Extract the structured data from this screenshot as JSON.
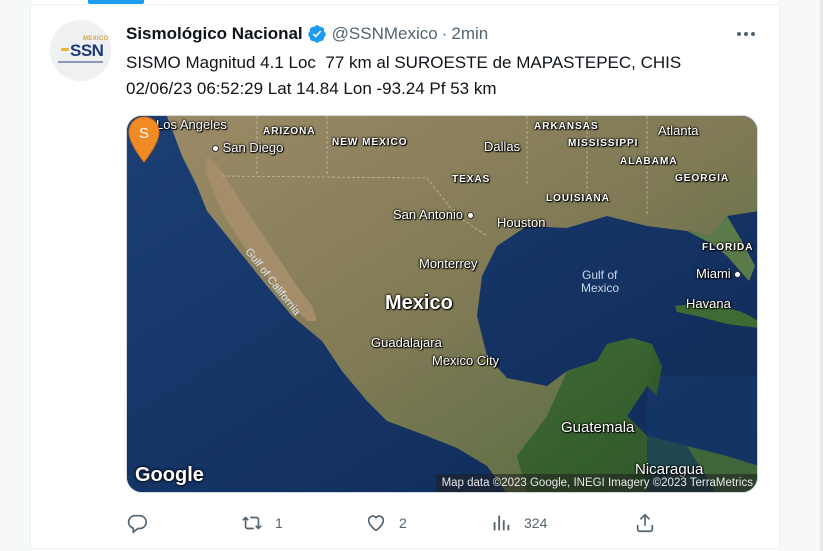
{
  "tweet": {
    "author": {
      "display_name": "Sismológico Nacional",
      "handle": "@SSNMexico",
      "avatar_text": "SSN",
      "avatar_top": "MEXICO"
    },
    "separator": "·",
    "time": "2min",
    "text_lines": [
      "SISMO Magnitud 4.1 Loc  77 km al SUROESTE de MAPASTEPEC, CHIS",
      "02/06/23 06:52:29 Lat 14.84 Lon -93.24 Pf 53 km"
    ],
    "map": {
      "labels": {
        "los_angeles": "Los Angeles",
        "arizona": "ARIZONA",
        "new_mexico": "NEW MEXICO",
        "arkansas": "ARKANSAS",
        "atlanta": "Atlanta",
        "san_diego": "San Diego",
        "dallas": "Dallas",
        "mississippi": "MISSISSIPPI",
        "alabama": "ALABAMA",
        "texas": "TEXAS",
        "georgia": "GEORGIA",
        "louisiana": "LOUISIANA",
        "san_antonio": "San Antonio",
        "houston": "Houston",
        "gulf_of_california": "Gulf of California",
        "florida": "FLORIDA",
        "monterrey": "Monterrey",
        "gulf_of_mexico_1": "Gulf of",
        "gulf_of_mexico_2": "Mexico",
        "miami": "Miami",
        "mexico": "Mexico",
        "havana": "Havana",
        "guadalajara": "Guadalajara",
        "mexico_city": "Mexico City",
        "guatemala": "Guatemala",
        "nicaragua": "Nicaragua"
      },
      "pin_letter": "S",
      "google_logo": "Google",
      "attribution": "Map data ©2023 Google, INEGI Imagery ©2023 TerraMetrics"
    },
    "actions": {
      "reply_count": "",
      "retweet_count": "1",
      "like_count": "2",
      "views_count": "324"
    },
    "colors": {
      "verified": "#1d9bf0",
      "pin": "#f08a24",
      "text_secondary": "#536471"
    }
  }
}
